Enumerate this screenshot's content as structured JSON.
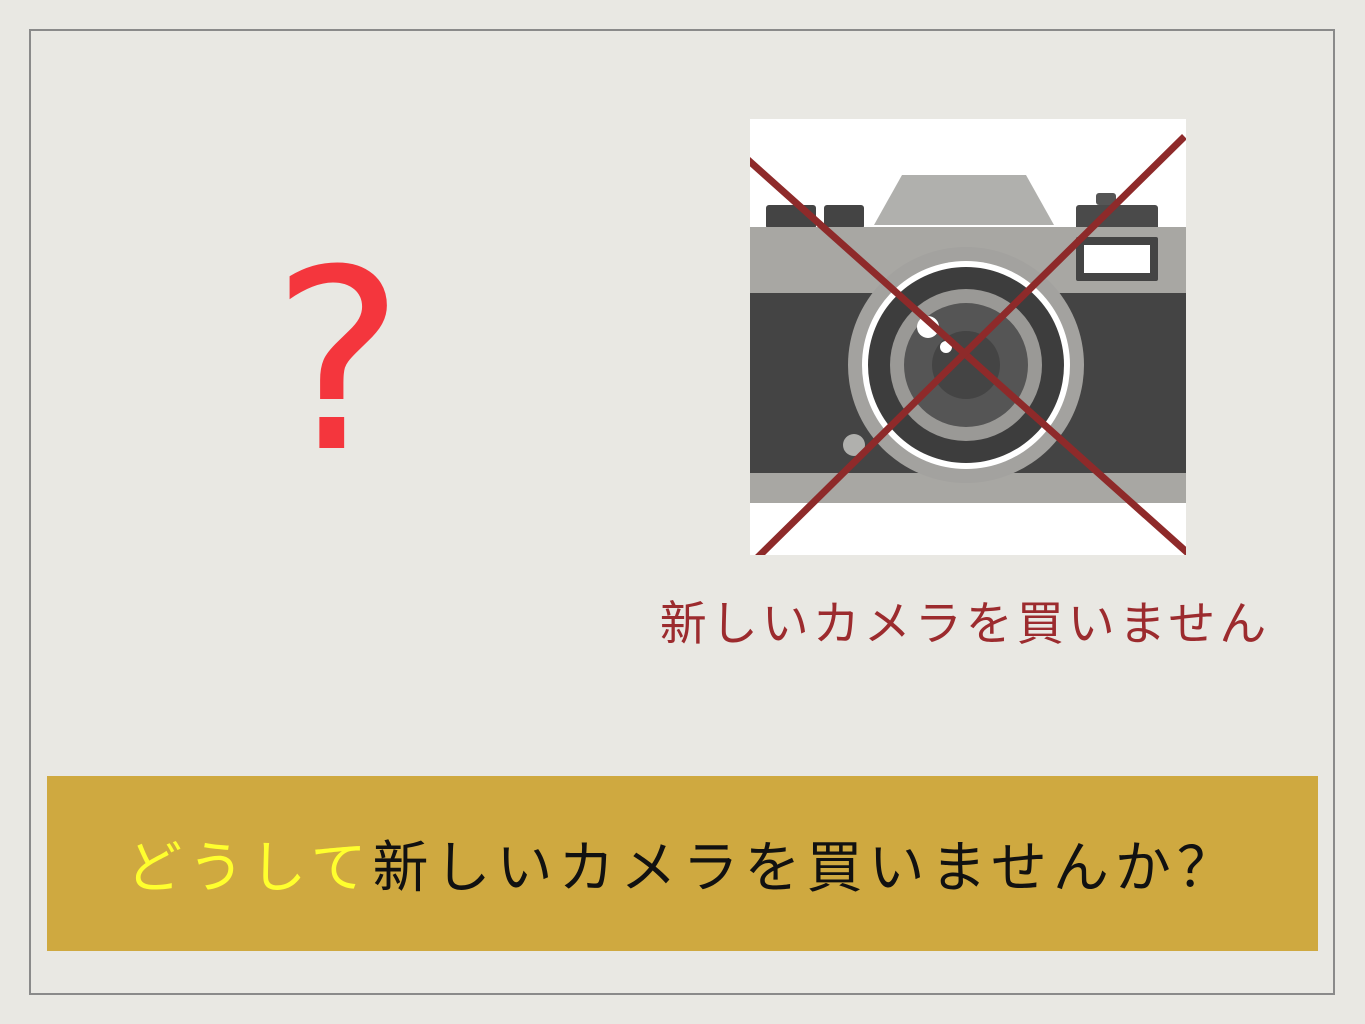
{
  "slide": {
    "question_symbol": "?",
    "caption": "新しいカメラを買いません",
    "banner": {
      "highlight": "どうして",
      "text": "新しいカメラを買いませんか？"
    }
  },
  "icons": {
    "camera": "camera-icon",
    "cross": "cross-mark-icon"
  },
  "colors": {
    "background": "#e9e8e3",
    "question": "#f4363d",
    "caption": "#9c2b2e",
    "cross": "#8e2a2a",
    "banner_bg": "#cfa940",
    "banner_highlight": "#ffff2e",
    "banner_text": "#111111"
  }
}
